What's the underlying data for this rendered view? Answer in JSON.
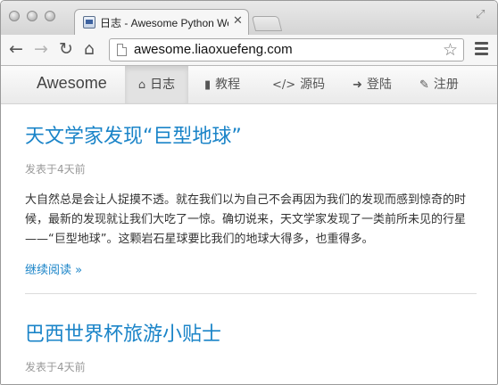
{
  "browser": {
    "tab_title": "日志 - Awesome Python Webapp",
    "tab_close_glyph": "✕",
    "url": "awesome.liaoxuefeng.com",
    "back_glyph": "←",
    "forward_glyph": "→",
    "reload_glyph": "↻",
    "home_glyph": "⌂",
    "star_glyph": "☆",
    "fullscreen_glyph": "⤢",
    "icons": [
      "traffic-light-close",
      "traffic-light-minimize",
      "traffic-light-zoom",
      "favicon",
      "close-icon",
      "back-arrow-icon",
      "forward-arrow-icon",
      "reload-icon",
      "home-icon",
      "page-icon",
      "bookmark-star-icon",
      "menu-icon",
      "fullscreen-icon"
    ]
  },
  "site": {
    "brand": "Awesome",
    "nav": [
      {
        "label": "日志",
        "icon": "home-icon",
        "glyph": "⌂",
        "active": true
      },
      {
        "label": "教程",
        "icon": "book-icon",
        "glyph": "▮",
        "active": false
      },
      {
        "label": "源码",
        "icon": "code-icon",
        "glyph": "</>",
        "active": false
      },
      {
        "label": "登陆",
        "icon": "sign-in-icon",
        "glyph": "➜",
        "active": false
      },
      {
        "label": "注册",
        "icon": "edit-icon",
        "glyph": "✎",
        "active": false
      }
    ]
  },
  "articles": [
    {
      "title": "天文学家发现“巨型地球”",
      "meta": "发表于4天前",
      "summary": "大自然总是会让人捉摸不透。就在我们以为自己不会再因为我们的发现而感到惊奇的时候，最新的发现就让我们大吃了一惊。确切说来，天文学家发现了一类前所未见的行星——“巨型地球”。这颗岩石星球要比我们的地球大得多，也重得多。",
      "read_more": "继续阅读 »"
    },
    {
      "title": "巴西世界杯旅游小贴士",
      "meta": "发表于4天前"
    }
  ],
  "colors": {
    "link": "#1a84c8",
    "meta": "#999999",
    "text": "#333333",
    "nav_active_bg": "#e2e2e2"
  }
}
